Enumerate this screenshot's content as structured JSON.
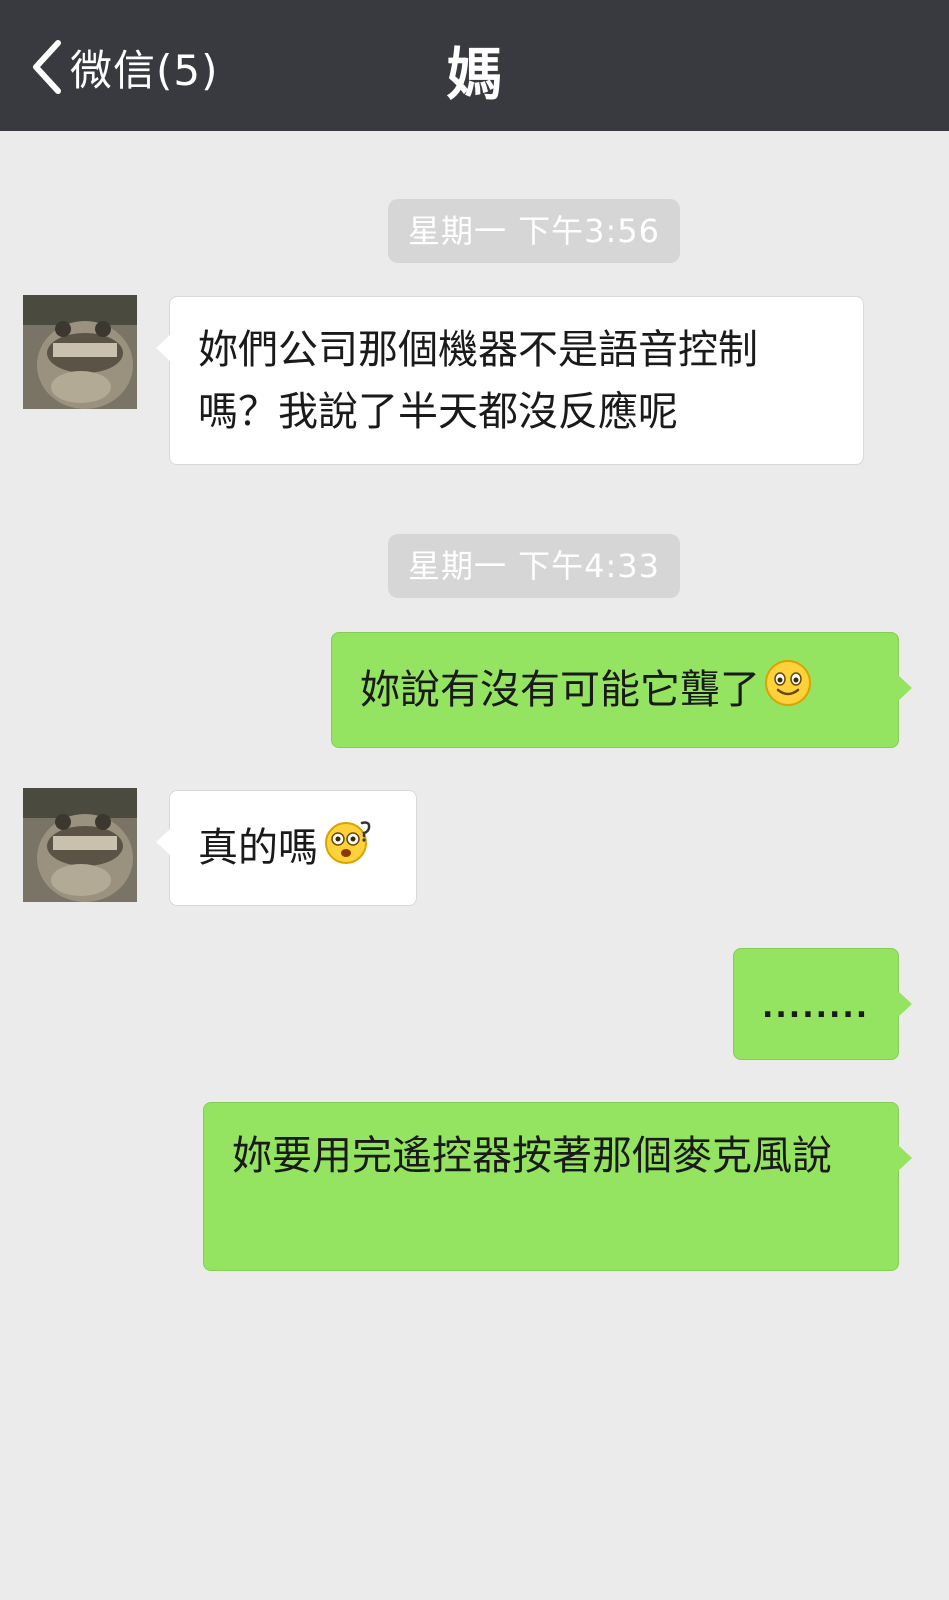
{
  "header": {
    "back_label": "微信(5)",
    "title": "媽"
  },
  "messages": [
    {
      "type": "time",
      "text": "星期一 下午3:56"
    },
    {
      "type": "received",
      "text": "妳們公司那個機器不是語音控制嗎？我說了半天都沒反應呢"
    },
    {
      "type": "time",
      "text": "星期一 下午4:33"
    },
    {
      "type": "sent",
      "text": "妳說有沒有可能它聾了",
      "emoji": "smile-emoji"
    },
    {
      "type": "received",
      "text": "真的嗎",
      "emoji": "shocked-question-emoji"
    },
    {
      "type": "sent",
      "text": "........"
    },
    {
      "type": "sent",
      "text": "妳要用完遙控器按著那個麥克風說"
    }
  ],
  "colors": {
    "header_bg": "#393a3f",
    "chat_bg": "#ebebeb",
    "sent_bubble": "#95e461",
    "received_bubble": "#ffffff",
    "timestamp_bg": "#d6d6d6"
  }
}
